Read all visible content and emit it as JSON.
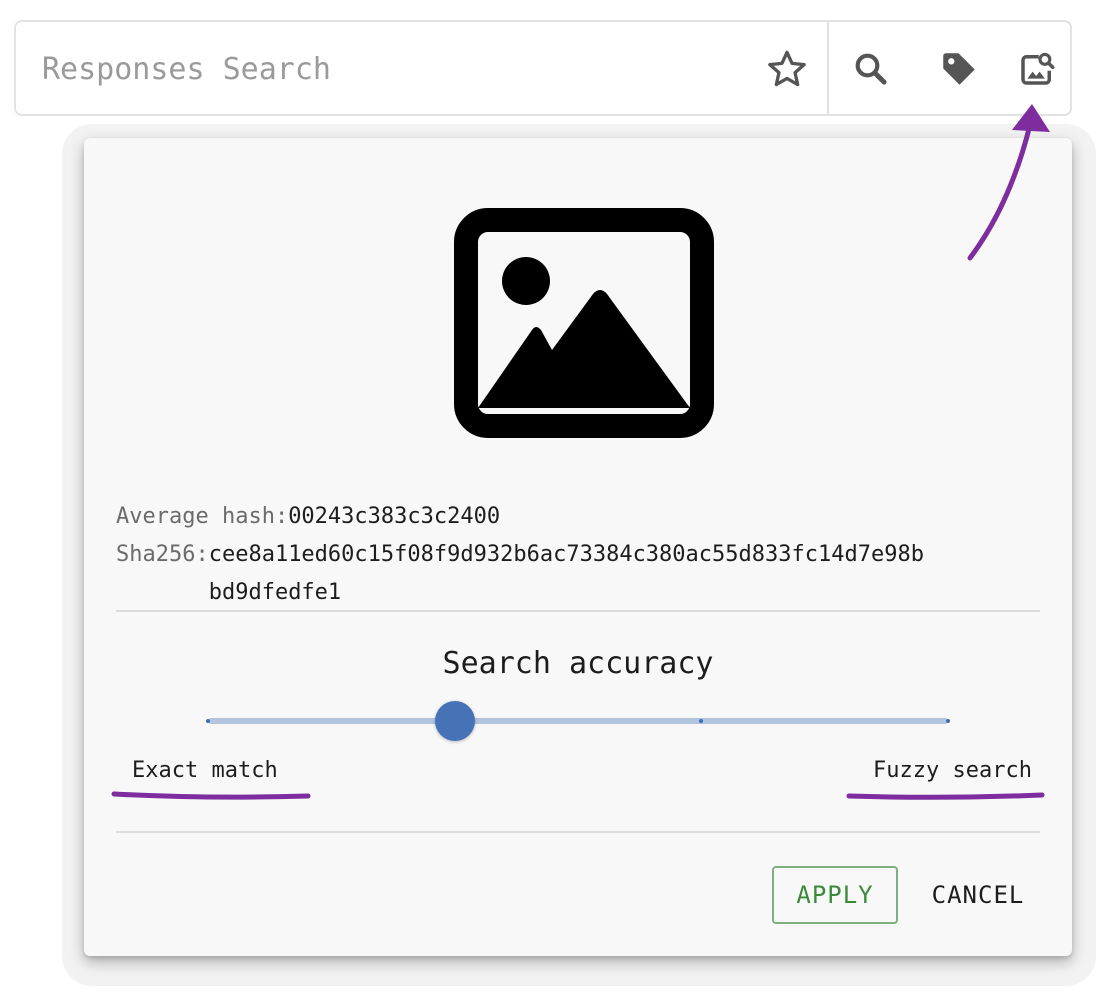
{
  "search": {
    "placeholder": "Responses Search",
    "value": ""
  },
  "toolbar": {
    "favorite_icon": "star-outline-icon",
    "search_icon": "magnifier-icon",
    "tag_icon": "tag-icon",
    "image_search_icon": "image-search-icon"
  },
  "dialog": {
    "preview_icon": "image-placeholder-icon",
    "average_hash_label": "Average hash:",
    "average_hash_value": "00243c383c3c2400",
    "sha256_label": "Sha256:",
    "sha256_value": "cee8a11ed60c15f08f9d932b6ac73384c380ac55d833fc14d7e98bbd9dfedfe1",
    "accuracy_title": "Search accuracy",
    "slider": {
      "steps": 3,
      "selected_step": 1,
      "left_label": "Exact match",
      "right_label": "Fuzzy search"
    },
    "apply_label": "APPLY",
    "cancel_label": "CANCEL"
  },
  "colors": {
    "accent": "#4672b6",
    "track": "#b2c4de",
    "apply": "#3b8a3b",
    "annotation": "#7e2d9e"
  }
}
